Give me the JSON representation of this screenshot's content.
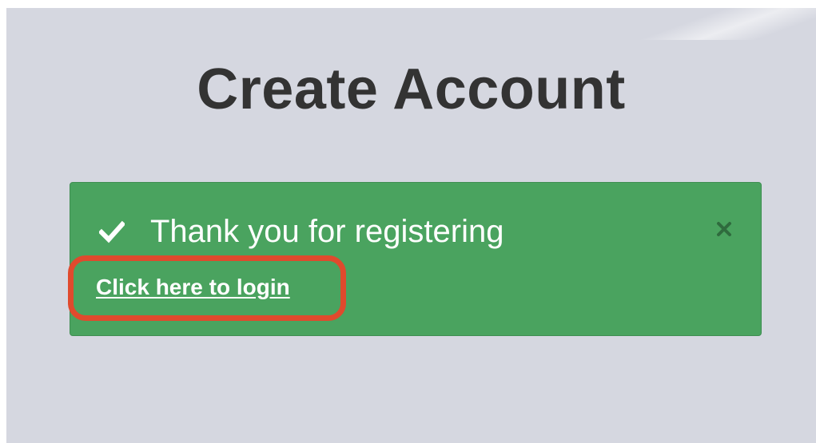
{
  "page": {
    "title": "Create Account"
  },
  "alert": {
    "message": "Thank you for registering",
    "login_link": "Click here to login",
    "close_label": "×",
    "icon": "check-icon",
    "colors": {
      "background": "#4aa35f",
      "text": "#ffffff",
      "highlight": "#e04a2d"
    }
  }
}
